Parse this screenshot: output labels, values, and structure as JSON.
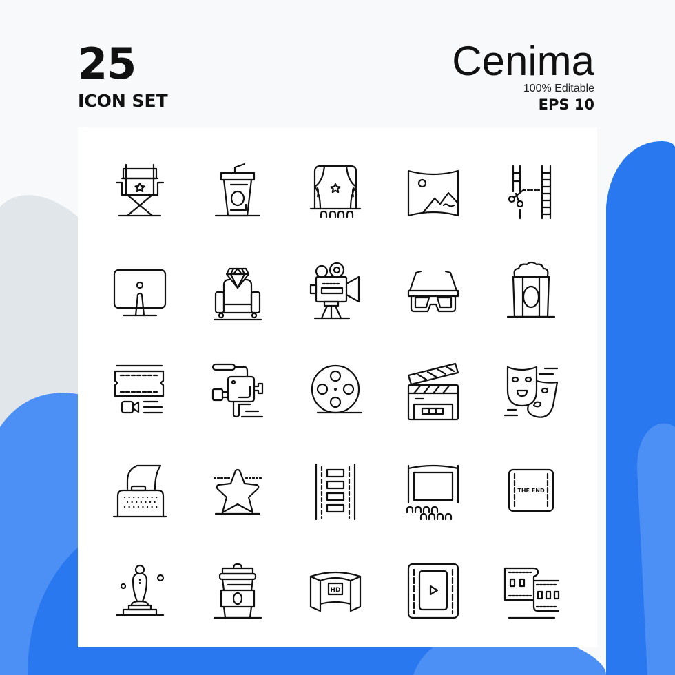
{
  "header": {
    "count": "25",
    "set_label": "ICON SET",
    "title": "Cenima",
    "editable": "100% Editable",
    "format": "EPS 10"
  },
  "colors": {
    "background": "#f7f9fb",
    "blob_gray": "#e1e6ea",
    "blob_blue": "#2a78f0",
    "blob_blue_light": "#4d90f5",
    "card": "#ffffff",
    "stroke": "#111111"
  },
  "icons": [
    {
      "name": "director-chair-icon"
    },
    {
      "name": "soda-cup-icon"
    },
    {
      "name": "theater-stage-icon"
    },
    {
      "name": "panorama-image-icon"
    },
    {
      "name": "film-cut-icon"
    },
    {
      "name": "monitor-icon"
    },
    {
      "name": "vip-seat-icon"
    },
    {
      "name": "film-projector-icon"
    },
    {
      "name": "3d-glasses-icon"
    },
    {
      "name": "popcorn-icon"
    },
    {
      "name": "ticket-video-icon"
    },
    {
      "name": "video-camera-icon"
    },
    {
      "name": "film-reel-icon"
    },
    {
      "name": "clapperboard-icon"
    },
    {
      "name": "theater-masks-icon"
    },
    {
      "name": "typewriter-icon"
    },
    {
      "name": "star-icon"
    },
    {
      "name": "film-strip-icon"
    },
    {
      "name": "cinema-screen-icon"
    },
    {
      "name": "the-end-icon",
      "label": "THE END"
    },
    {
      "name": "award-statue-icon"
    },
    {
      "name": "coffee-cup-icon"
    },
    {
      "name": "hd-screen-icon",
      "label": "HD"
    },
    {
      "name": "video-player-icon"
    },
    {
      "name": "film-roll-icon"
    }
  ]
}
